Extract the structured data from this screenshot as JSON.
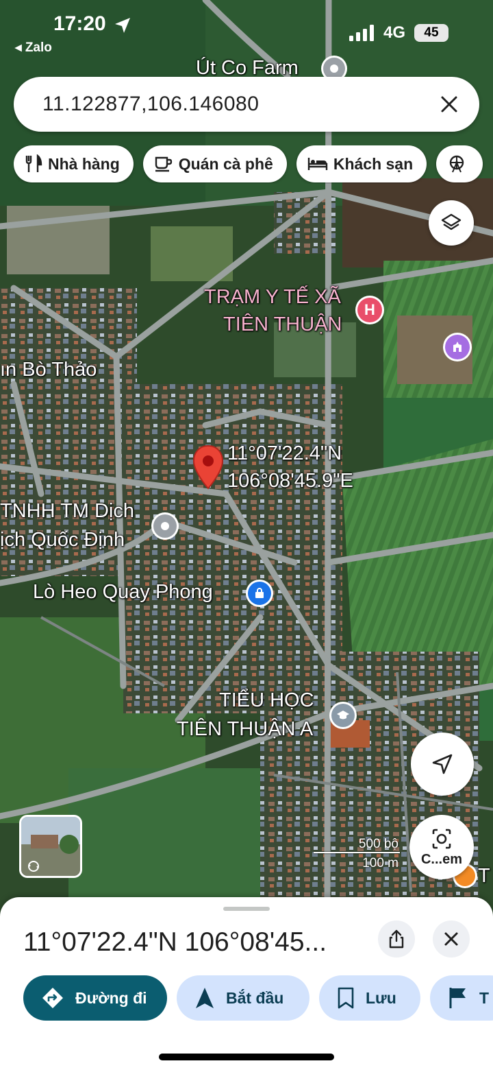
{
  "status_bar": {
    "time": "17:20",
    "back_app": "◂ Zalo",
    "network": "4G",
    "battery": "45"
  },
  "search": {
    "value": "11.122877,106.146080"
  },
  "chips": [
    {
      "label": "Nhà hàng",
      "icon": "utensils-icon"
    },
    {
      "label": "Quán cà phê",
      "icon": "coffee-icon"
    },
    {
      "label": "Khách sạn",
      "icon": "bed-icon"
    }
  ],
  "map": {
    "labels": {
      "ut_co_farm": "Út Co Farm",
      "tram_y_te_line1": "TRẠM Y TẾ XÃ",
      "tram_y_te_line2": "TIÊN THUẬN",
      "bun_bo_thao": "ın Bò Thảo",
      "pin_lat": "11°07'22.4\"N",
      "pin_lng": "106°08'45.9\"E",
      "tnhh_line1": "TNHH TM Dịch",
      "tnhh_line2": "ịch Quốc Định",
      "lo_heo": "Lò Heo Quay Phong",
      "tieu_hoc_line1": "TIỂU HỌC",
      "tieu_hoc_line2": "TIÊN THUẬN A",
      "edge_t": "T"
    },
    "hospital_glyph": "H",
    "scale_top": "500 bộ",
    "scale_bottom": "100 m",
    "lens_label": "C...em"
  },
  "sheet": {
    "title": "11°07'22.4\"N 106°08'45...",
    "actions": [
      {
        "label": "Đường đi",
        "icon": "directions-icon"
      },
      {
        "label": "Bắt đầu",
        "icon": "navigation-icon"
      },
      {
        "label": "Lưu",
        "icon": "bookmark-icon"
      },
      {
        "label": "T",
        "icon": "flag-icon"
      }
    ]
  },
  "colors": {
    "accent": "#0b5d70",
    "chip_bg": "#d3e3fd",
    "pin": "#ea4335",
    "hospital": "#e94e6a",
    "poi_blue": "#1a73e8"
  }
}
